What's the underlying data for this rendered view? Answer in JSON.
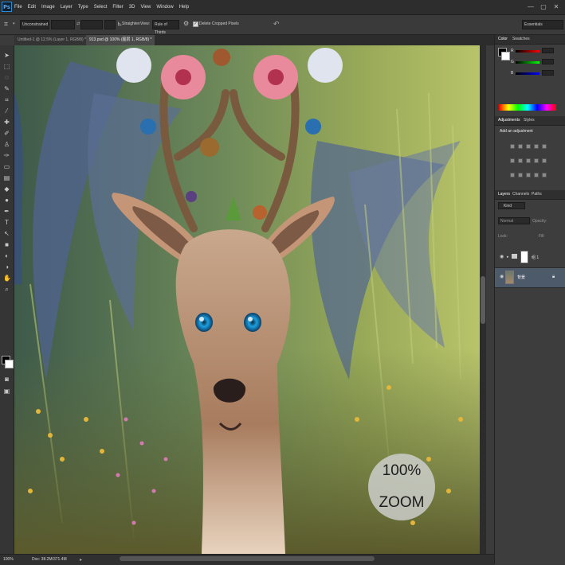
{
  "app": {
    "logo": "Ps"
  },
  "menu": [
    "File",
    "Edit",
    "Image",
    "Layer",
    "Type",
    "Select",
    "Filter",
    "3D",
    "View",
    "Window",
    "Help"
  ],
  "window_controls": [
    "—",
    "▢",
    "✕"
  ],
  "options": {
    "style_value": "Unconstrained",
    "straighten_label": "Straighten",
    "view_label": "View:",
    "view_value": "Rule of Thirds",
    "delete_cropped_label": "Delete Cropped Pixels",
    "workspace": "Essentials"
  },
  "tabs": [
    {
      "label": "Untitled-1 @ 12.5% (Layer 1, RGB/8) *"
    },
    {
      "label": "913.psd @ 100% (图层 1, RGB/8) *"
    }
  ],
  "canvas_overlay": {
    "line1": "100%",
    "line2": "ZOOM"
  },
  "status": {
    "zoom": "100%",
    "doc": "Doc: 38.2M/371.4M"
  },
  "color_panel": {
    "tabs": [
      "Color",
      "Swatches"
    ],
    "labels": [
      "R",
      "G",
      "B"
    ]
  },
  "adjustments_panel": {
    "tabs": [
      "Adjustments",
      "Styles"
    ],
    "title": "Add an adjustment"
  },
  "layers_panel": {
    "tabs": [
      "Layers",
      "Channels",
      "Paths"
    ],
    "kind_filter": "Kind",
    "blend_mode": "Normal",
    "opacity_label": "Opacity:",
    "lock_label": "Lock:",
    "fill_label": "Fill:",
    "layers": [
      {
        "name": "组 1"
      },
      {
        "name": "背景"
      }
    ]
  },
  "colors": {
    "accent": "#2e8bd1",
    "ui_bg": "#3b3b3b",
    "selected_layer": "#4d5a6a"
  }
}
